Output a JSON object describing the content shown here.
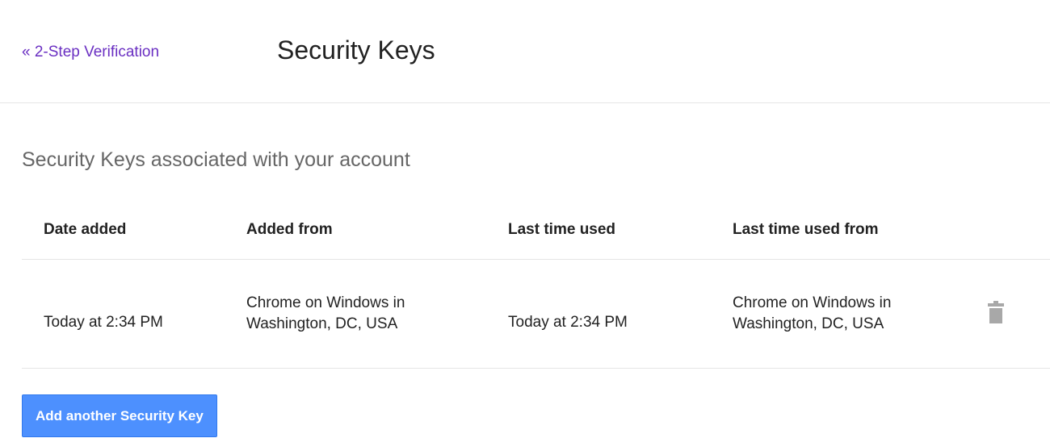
{
  "header": {
    "back_link": "« 2-Step Verification",
    "title": "Security Keys"
  },
  "section": {
    "heading": "Security Keys associated with your account"
  },
  "table": {
    "columns": [
      "Date added",
      "Added from",
      "Last time used",
      "Last time used from"
    ],
    "rows": [
      {
        "date_added": "Today at 2:34 PM",
        "added_from_line1": "Chrome on Windows in",
        "added_from_line2": "Washington, DC, USA",
        "last_used": "Today at 2:34 PM",
        "last_used_from_line1": "Chrome on Windows in",
        "last_used_from_line2": "Washington, DC, USA",
        "action_icon": "trash-icon"
      }
    ]
  },
  "actions": {
    "add_key_label": "Add another Security Key"
  },
  "colors": {
    "link": "#6a2fc2",
    "primary_button": "#4d90fe",
    "divider": "#e5e5e5",
    "icon": "#a8a8a8"
  }
}
